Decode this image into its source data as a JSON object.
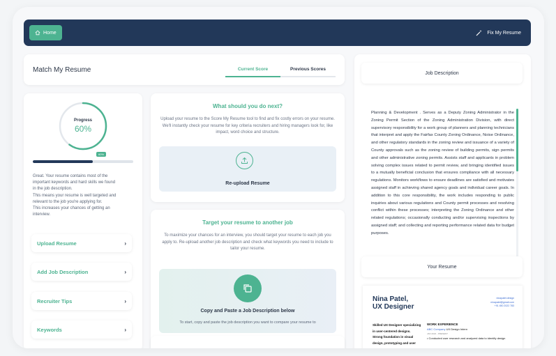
{
  "topbar": {
    "home_label": "Home",
    "fix_label": "Fix My Resume",
    "bg_color": "#223859",
    "accent_color": "#4db391"
  },
  "header": {
    "title": "Match My Resume",
    "tabs": [
      {
        "label": "Current Score",
        "active": true
      },
      {
        "label": "Previous Scores",
        "active": false
      }
    ]
  },
  "progress": {
    "label": "Progress",
    "value_text": "60%",
    "value": 60,
    "bar_badge": "60%",
    "bar_value": 0.6
  },
  "info_text": [
    "Great. Your resume contains most of the",
    "important keywords and hard skills we found",
    "in the job description.",
    "This means your resume is well targeted and",
    "relevant to the job you're applying for.",
    "This increases your chances of getting an",
    "interview."
  ],
  "menu": [
    {
      "label": "Upload Resume"
    },
    {
      "label": "Add Job Description"
    },
    {
      "label": "Recruiter Tips"
    },
    {
      "label": "Keywords"
    }
  ],
  "next_steps": {
    "title": "What should you do next?",
    "text": "Upload your resume to the Score My Resume tool to find and fix costly errors on your resume. We'll instantly check your resume for key criteria recruiters and hiring managers look for, like impact, word choice and structure.",
    "button_label": "Re-upload Resume"
  },
  "target": {
    "title": "Target your resume to another job",
    "text": "To maximize your chances for an interview, you should target your resume to each job you apply to. Re-upload another job description and check what keywords you need to include to tailor your resume.",
    "paste_title": "Copy and Paste a Job Description below",
    "paste_sub": "To start, copy and paste the job description you want to compare your resume to"
  },
  "job_description": {
    "heading": "Job Description",
    "text": "Planning & Development . Serves as a Deputy Zoning Administrator in the Zoning Permit Section of the Zoning Administration Division, with direct supervisory responsibility for a work group of planners and planning technicians that interpret and apply the Fairfax County Zoning Ordinance, Noise Ordinance, and other regulatory standards in the zoning review and issuance of a variety of County approvals such as the zoning review of building permits, sign permits and other administrative zoning permits. Assists staff and applicants in problem solving complex issues related to permit review, and bringing identified issues to a mutually beneficial conclusion that ensures compliance with all necessary regulations. Monitors workflows to ensure deadlines are satisfied and motivates assigned staff in achieving shared agency goals and individual career goals. In addition to this core responsibility, the work includes responding to public inquiries about various regulations and County permit processes and resolving conflict within these processes; interpreting the Zoning Ordinance and other related regulations; occasionally conducting and/or supervising inspections by assigned staff; and collecting and reporting performance related data for budget purposes."
  },
  "resume": {
    "heading": "Your Resume",
    "name_line1": "Nina Patel,",
    "name_line2": "UX Designer",
    "contact": [
      "ninapatel.design",
      "ninapatel@gmail.com",
      "+91 450 2022 783"
    ],
    "summary": "Skilled UX Designer specializing in user-centered designs. Strong foundation in visual design, prototyping and user",
    "work_heading": "WORK EXPERIENCE",
    "company": "ABC Company",
    "role": "UX Design Intern",
    "dates": "JAN 2022 - PRESENT",
    "bullet": "Conducted user research and analyzed data to identify design"
  }
}
